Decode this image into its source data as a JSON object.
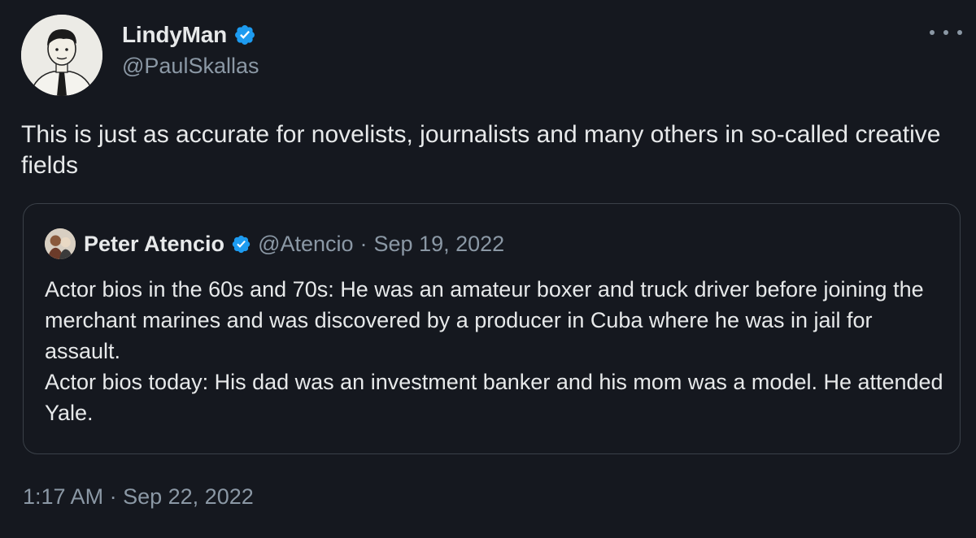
{
  "author": {
    "display_name": "LindyMan",
    "handle": "@PaulSkallas",
    "verified": true
  },
  "tweet": {
    "text": "This is just as accurate for novelists, journalists and many others in so-called creative fields",
    "time": "1:17 AM",
    "separator": "·",
    "date": "Sep 22, 2022"
  },
  "quoted": {
    "display_name": "Peter Atencio",
    "handle": "@Atencio",
    "separator": "·",
    "date": "Sep 19, 2022",
    "lines": [
      "Actor bios in the 60s and 70s: He was an amateur boxer and truck driver before joining the merchant marines and was discovered by a producer in Cuba where he was in jail for assault.",
      "Actor bios today: His dad was an investment banker and his mom was a model. He attended Yale."
    ]
  },
  "colors": {
    "background": "#15181f",
    "text_primary": "#e7e9ea",
    "text_secondary": "#8b98a5",
    "verified_badge": "#1d9bf0",
    "card_border": "#3a4048"
  },
  "icons": {
    "more": "more-horizontal-icon",
    "verified": "verified-badge-icon"
  }
}
